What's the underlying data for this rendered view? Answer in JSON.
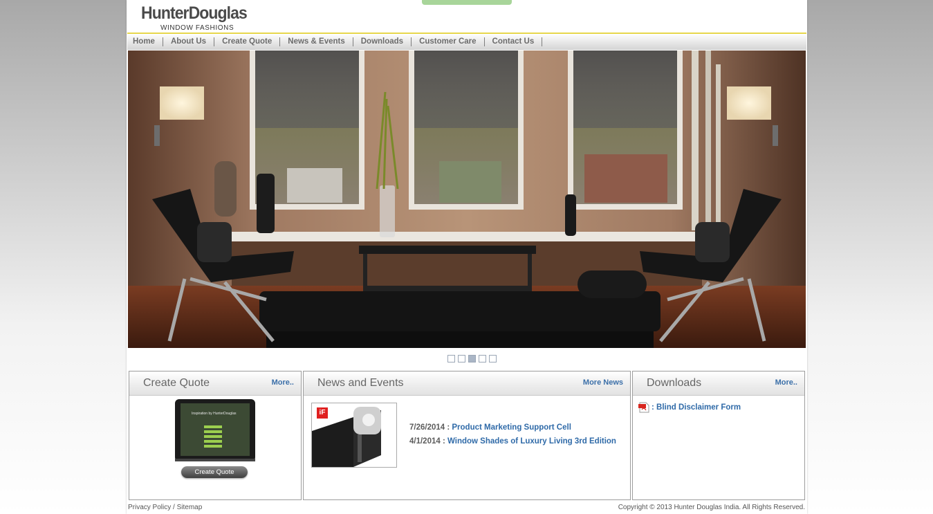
{
  "header": {
    "logo_main": "HunterDouglas",
    "logo_sub": "WINDOW FASHIONS"
  },
  "nav": {
    "items": [
      {
        "label": "Home"
      },
      {
        "label": "About Us"
      },
      {
        "label": "Create Quote"
      },
      {
        "label": "News & Events"
      },
      {
        "label": "Downloads"
      },
      {
        "label": "Customer Care"
      },
      {
        "label": "Contact Us"
      }
    ]
  },
  "slider": {
    "active_index": 3,
    "total": 5
  },
  "create_quote": {
    "title": "Create Quote",
    "more": "More..",
    "tablet_caption": "Inspiration by HunterDouglas",
    "button_label": "Create Quote"
  },
  "news": {
    "title": "News and Events",
    "more": "More News",
    "thumb_badge": "iF",
    "items": [
      {
        "date": "7/26/2014 :",
        "title": "Product Marketing Support Cell"
      },
      {
        "date": "4/1/2014 :",
        "title": "Window Shades of Luxury Living 3rd Edition"
      }
    ]
  },
  "downloads": {
    "title": "Downloads",
    "more": "More..",
    "items": [
      {
        "label": ": Blind Disclaimer Form"
      }
    ]
  },
  "footer": {
    "privacy": "Privacy Policy",
    "separator": " / ",
    "sitemap": "Sitemap",
    "copyright": "Copyright © 2013 Hunter Douglas India. All Rights Reserved."
  },
  "colors": {
    "accent_yellow": "#e7d74b",
    "link_blue": "#2f6aa8",
    "tab_green": "#a8d59a"
  }
}
